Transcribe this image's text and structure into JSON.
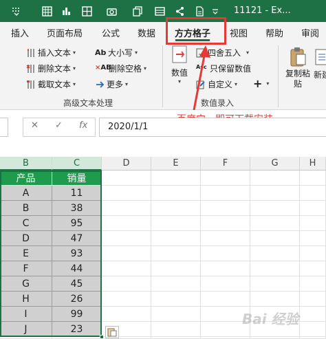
{
  "quick_access": {
    "items": [
      "customize-icon",
      "excel-icon",
      "save-icon",
      "table-icon",
      "grid-icon",
      "camera-icon",
      "copy-icon",
      "share-icon",
      "new-doc-icon"
    ]
  },
  "window": {
    "title": "11121 - Ex..."
  },
  "tabs": [
    {
      "label": "插入"
    },
    {
      "label": "页面布局"
    },
    {
      "label": "公式"
    },
    {
      "label": "数据"
    },
    {
      "label": "方方格子",
      "active": true
    },
    {
      "label": "视图"
    },
    {
      "label": "帮助"
    },
    {
      "label": "审阅"
    }
  ],
  "ribbon": {
    "text_group": {
      "insert_text": "插入文本",
      "delete_text": "删除文本",
      "cut_text": "截取文本",
      "case_label": "大小写",
      "delete_space": "删除空格",
      "more": "更多",
      "group_label": "高级文本处理"
    },
    "number_group": {
      "number_button": "数值",
      "round": "四舍五入",
      "keep_value": "只保留数值",
      "custom": "自定义",
      "plus": "+",
      "group_label": "数值录入"
    },
    "copy_paste": "复制粘贴",
    "new_label": "新建"
  },
  "annotation": "百度它，即可下载安装",
  "formula_bar": {
    "value": "2020/1/1",
    "fx": "fx"
  },
  "grid": {
    "columns": [
      "B",
      "C",
      "D",
      "E",
      "F",
      "G",
      "H"
    ],
    "header": [
      "产品",
      "销量"
    ],
    "rows": [
      [
        "A",
        "11"
      ],
      [
        "B",
        "38"
      ],
      [
        "C",
        "95"
      ],
      [
        "D",
        "47"
      ],
      [
        "E",
        "93"
      ],
      [
        "F",
        "44"
      ],
      [
        "G",
        "45"
      ],
      [
        "H",
        "26"
      ],
      [
        "I",
        "99"
      ],
      [
        "J",
        "23"
      ]
    ]
  },
  "watermark": "Bai 经验",
  "colors": {
    "accent": "#1e7145",
    "header_fill": "#1e9b4d",
    "cell_fill": "#d0d0d0",
    "annotation": "#e53935"
  }
}
